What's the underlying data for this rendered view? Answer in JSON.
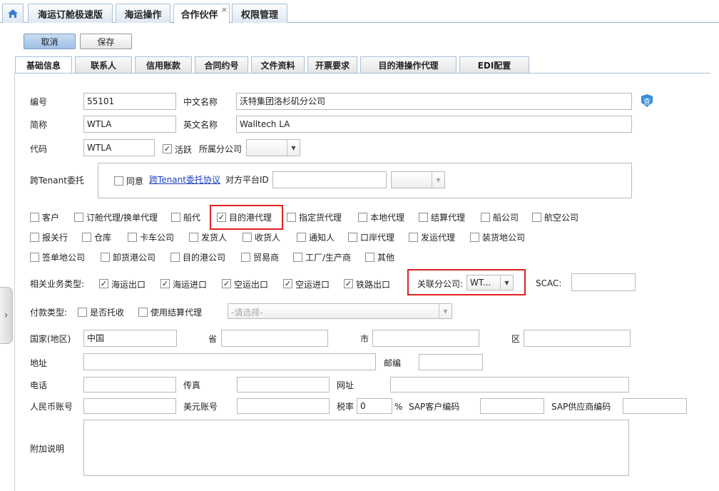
{
  "top_tabs": [
    {
      "label": "海运订舱极速版"
    },
    {
      "label": "海运操作"
    },
    {
      "label": "合作伙伴",
      "close": "×"
    },
    {
      "label": "权限管理"
    }
  ],
  "actions": {
    "cancel": "取消",
    "save": "保存"
  },
  "sub_tabs": [
    "基础信息",
    "联系人",
    "信用账款",
    "合同约号",
    "文件资料",
    "开票要求",
    "目的港操作代理",
    "EDI配置"
  ],
  "form": {
    "code_no_label": "编号",
    "code_no": "55101",
    "cn_name_label": "中文名称",
    "cn_name": "沃特集团洛杉矶分公司",
    "short_label": "简称",
    "short": "WTLA",
    "en_name_label": "英文名称",
    "en_name": "Walltech LA",
    "code_label": "代码",
    "code": "WTLA",
    "active_label": "活跃",
    "branch_label": "所属分公司",
    "lookup_icon": "查",
    "cross_tenant_label": "跨Tenant委托",
    "agree_label": "同意",
    "agreement_link": "跨Tenant委托协议",
    "platform_id_label": "对方平台ID"
  },
  "roles": [
    {
      "label": "客户",
      "checked": false
    },
    {
      "label": "订舱代理/换单代理",
      "checked": false
    },
    {
      "label": "船代",
      "checked": false
    },
    {
      "label": "目的港代理",
      "checked": true
    },
    {
      "label": "指定货代理",
      "checked": false
    },
    {
      "label": "本地代理",
      "checked": false
    },
    {
      "label": "结算代理",
      "checked": false
    },
    {
      "label": "船公司",
      "checked": false
    },
    {
      "label": "航空公司",
      "checked": false
    },
    {
      "label": "报关行",
      "checked": false
    },
    {
      "label": "仓库",
      "checked": false
    },
    {
      "label": "卡车公司",
      "checked": false
    },
    {
      "label": "发货人",
      "checked": false
    },
    {
      "label": "收货人",
      "checked": false
    },
    {
      "label": "通知人",
      "checked": false
    },
    {
      "label": "口岸代理",
      "checked": false
    },
    {
      "label": "发运代理",
      "checked": false
    },
    {
      "label": "装货地公司",
      "checked": false
    },
    {
      "label": "签单地公司",
      "checked": false
    },
    {
      "label": "卸货港公司",
      "checked": false
    },
    {
      "label": "目的港公司",
      "checked": false
    },
    {
      "label": "贸易商",
      "checked": false
    },
    {
      "label": "工厂/生产商",
      "checked": false
    },
    {
      "label": "其他",
      "checked": false
    }
  ],
  "business": {
    "label": "相关业务类型:",
    "types": [
      {
        "label": "海运出口",
        "checked": true
      },
      {
        "label": "海运进口",
        "checked": true
      },
      {
        "label": "空运出口",
        "checked": true
      },
      {
        "label": "空运进口",
        "checked": true
      },
      {
        "label": "铁路出口",
        "checked": true
      }
    ],
    "related_branch_label": "关联分公司:",
    "related_branch_value": "WT...",
    "scac_label": "SCAC:"
  },
  "payment": {
    "label": "付款类型:",
    "consign_label": "是否托收",
    "settle_label": "使用结算代理",
    "select_placeholder": "-请选择-"
  },
  "address": {
    "country_label": "国家(地区)",
    "country": "中国",
    "province_label": "省",
    "city_label": "市",
    "district_label": "区",
    "address_label": "地址",
    "postcode_label": "邮编",
    "phone_label": "电话",
    "fax_label": "传真",
    "website_label": "网址",
    "rmb_label": "人民币账号",
    "usd_label": "美元账号",
    "tax_label": "税率",
    "tax": "0",
    "percent": "%",
    "sap_customer_label": "SAP客户编码",
    "sap_vendor_label": "SAP供应商编码",
    "remark_label": "附加说明"
  },
  "icons": {
    "home": "home-icon",
    "lookup": "shield-lookup-icon",
    "expand": "chevron-right-icon"
  },
  "colors": {
    "highlight": "#e02020",
    "tab_border": "#a9bfd6",
    "link": "#1a3ec0"
  }
}
